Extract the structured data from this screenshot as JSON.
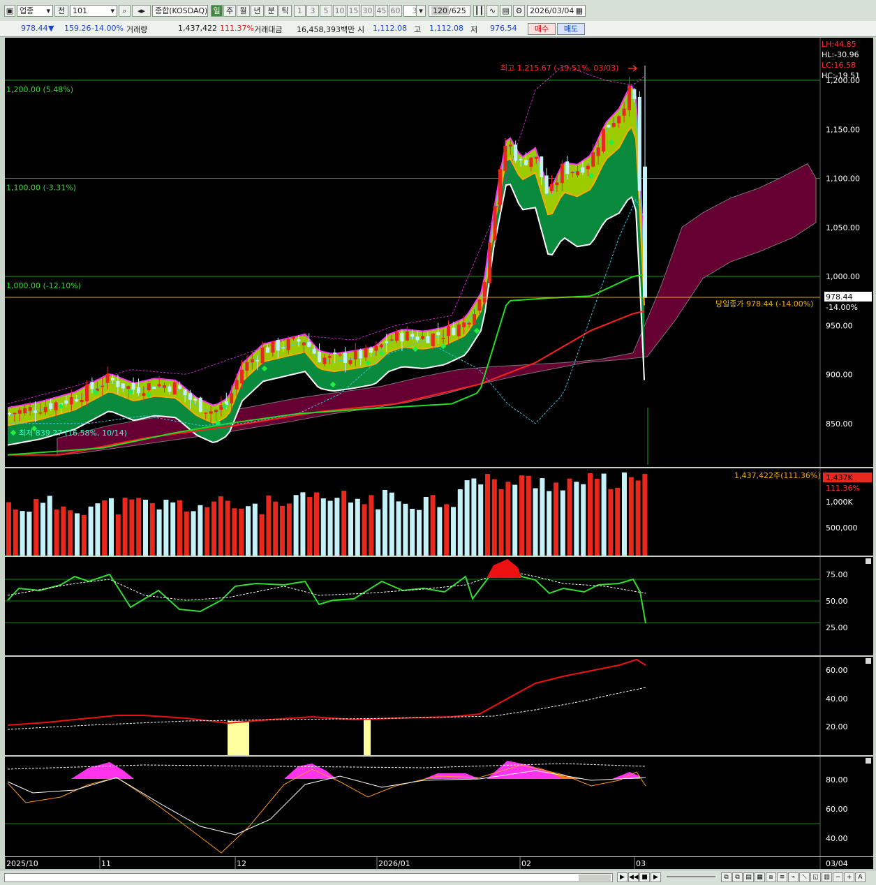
{
  "toolbar": {
    "category": "업종",
    "prev_label": "전",
    "code": "101",
    "index_name": "종합(KOSDAQ)",
    "periods": [
      "일",
      "주",
      "월",
      "년",
      "분",
      "틱"
    ],
    "minute_options": [
      "1",
      "3",
      "5",
      "10",
      "15",
      "30",
      "45",
      "60"
    ],
    "minute_value": "3",
    "count_display": "120",
    "count_total": "/625",
    "date": "2026/03/04"
  },
  "quote": {
    "price": "978.44",
    "arrow": "▼",
    "change": "159.26",
    "change_pct": "-14.00%",
    "volume_label": "거래량",
    "volume": "1,437,422",
    "volume_pct": "111.37%",
    "amount_label": "거래대금",
    "amount": "16,458,393백만",
    "open_label": "시",
    "open": "1,112.08",
    "high_label": "고",
    "high": "1,112.08",
    "low_label": "저",
    "low": "976.54",
    "buy_label": "매수",
    "sell_label": "매도"
  },
  "price_panel": {
    "levels": [
      {
        "label": "1,200.00 (5.48%)",
        "value": 1200
      },
      {
        "label": "1,100.00 (-3.31%)",
        "value": 1100
      },
      {
        "label": "1,000.00 (-12.10%)",
        "value": 1000
      }
    ],
    "y_ticks": [
      "1,200.00",
      "1,150.00",
      "1,100.00",
      "1,050.00",
      "1,000.00",
      "950.00",
      "900.00",
      "850.00"
    ],
    "high_note": "최고 1,215.67 (-19.51%, 03/03)",
    "low_note": "최저 839.27 (16.58%, 10/14)",
    "close_note": "당일종가 978.44 (-14.00%)",
    "current_price": "978.44",
    "current_pct": "-14.00%",
    "stats": {
      "lh": "LH:44.85",
      "hl": "HL:-30.96",
      "lc": "LC:16.58",
      "hc": "HC:-19.51"
    }
  },
  "volume_panel": {
    "label": "1,437,422주(111.36%)",
    "badge": "1,437K",
    "badge_pct": "111.36%",
    "y_ticks": [
      "1,000K",
      "500,000"
    ]
  },
  "osc1": {
    "y_ticks": [
      "75.00",
      "50.00",
      "25.00"
    ]
  },
  "osc2": {
    "y_ticks": [
      "60.00",
      "40.00",
      "20.00"
    ]
  },
  "osc3": {
    "y_ticks": [
      "80.00",
      "60.00",
      "40.00"
    ]
  },
  "x_axis": {
    "labels": [
      {
        "text": "2025/10",
        "x": 2
      },
      {
        "text": "11",
        "x": 138
      },
      {
        "text": "12",
        "x": 332
      },
      {
        "text": "2026/01",
        "x": 535
      },
      {
        "text": "02",
        "x": 740
      },
      {
        "text": "03",
        "x": 904
      }
    ],
    "right_label": "03/04"
  },
  "colors": {
    "up": "#e8281c",
    "down": "#c4f2f8",
    "cloud": "#660033",
    "band_light": "#9ccc00",
    "band_dark": "#0a8a3c",
    "pink": "#ff33ff"
  }
}
